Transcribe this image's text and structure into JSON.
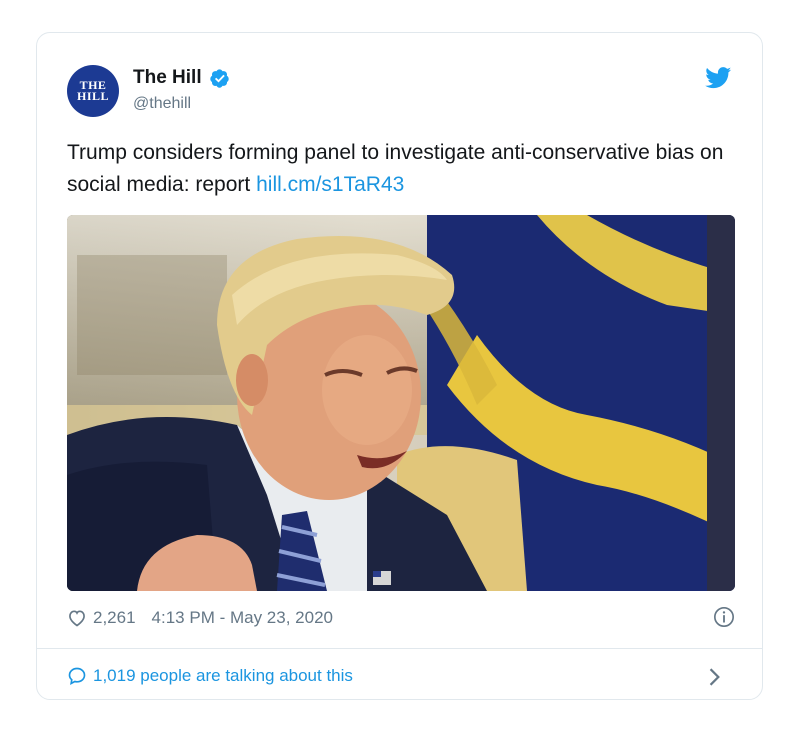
{
  "tweet": {
    "avatar_text_line1": "THE",
    "avatar_text_line2": "HILL",
    "display_name": "The Hill",
    "handle": "@thehill",
    "text": "Trump considers forming panel to investigate anti-conservative bias on social media: report ",
    "link_text": "hill.cm/s1TaR43",
    "likes": "2,261",
    "timestamp": "4:13 PM - May 23, 2020",
    "talking": "1,019 people are talking about this"
  },
  "icons": {
    "verified": "verified-badge-icon",
    "brand": "twitter-bird-icon",
    "like": "heart-icon",
    "info": "info-icon",
    "reply": "speech-bubble-icon",
    "chevron": "chevron-right-icon"
  },
  "colors": {
    "accent": "#1b95e0",
    "verified": "#1da1f2",
    "avatar_bg": "#1c3a93",
    "secondary_text": "#657786",
    "border": "#e1e8ed"
  }
}
